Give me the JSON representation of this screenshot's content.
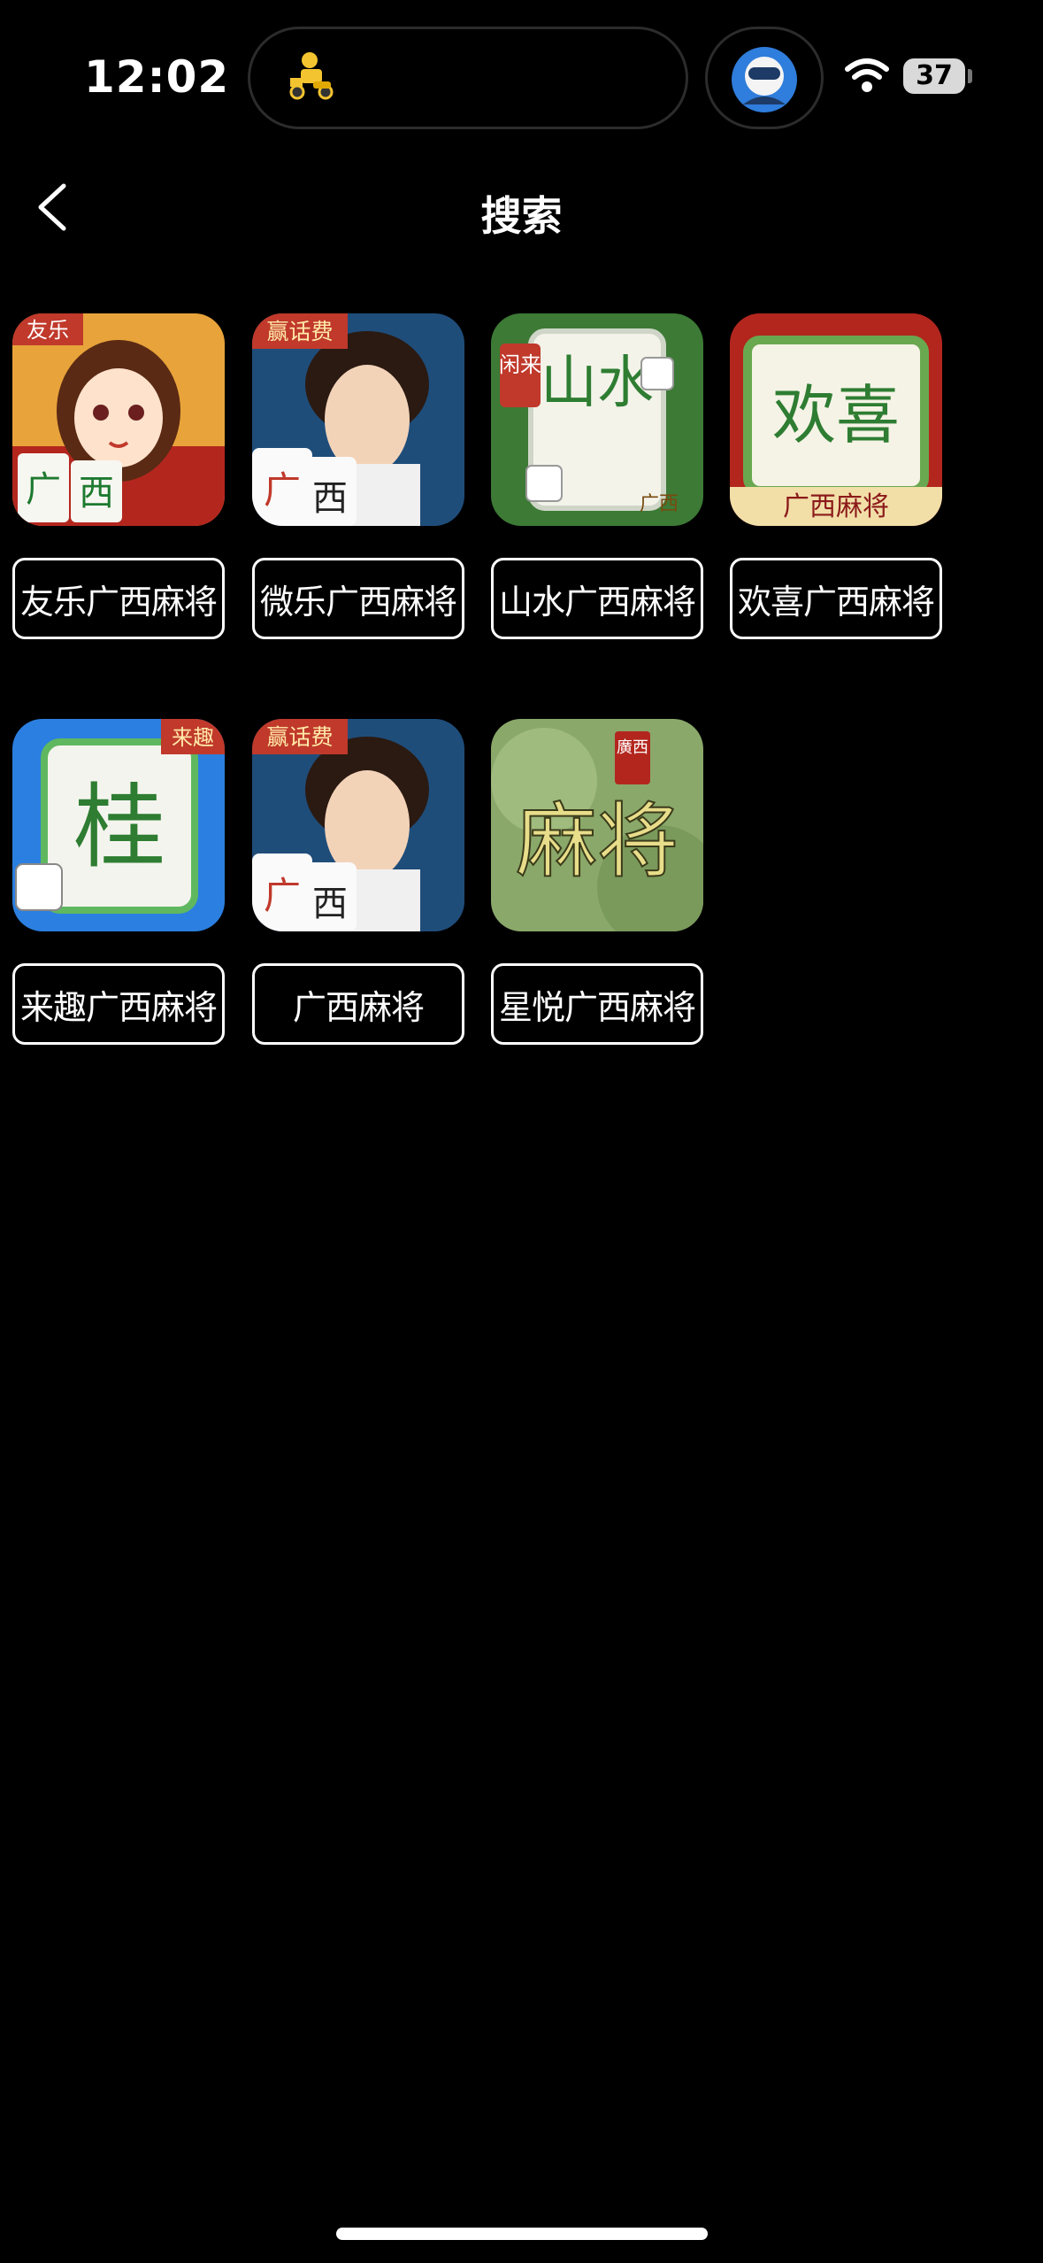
{
  "status_bar": {
    "time": "12:02",
    "battery": "37"
  },
  "header": {
    "title": "搜索"
  },
  "apps": [
    {
      "name": "友乐广西麻将",
      "icon": "girl-mahjong-icon",
      "badge": "友乐",
      "tiles": [
        "广",
        "西"
      ]
    },
    {
      "name": "微乐广西麻将",
      "icon": "man-cards-icon",
      "badge": "赢话费",
      "tiles": [
        "广",
        "西"
      ]
    },
    {
      "name": "山水广西麻将",
      "icon": "shanshui-tile-icon",
      "badge": "闲来",
      "big": "山水",
      "corner": "广西"
    },
    {
      "name": "欢喜广西麻将",
      "icon": "huanxi-tiles-icon",
      "big": "欢喜",
      "banner": "广西麻将"
    },
    {
      "name": "来趣广西麻将",
      "icon": "gui-tile-icon",
      "badge": "来趣",
      "big": "桂"
    },
    {
      "name": "广西麻将",
      "icon": "man-cards-icon",
      "badge": "赢话费",
      "tiles": [
        "广",
        "西"
      ]
    },
    {
      "name": "星悦广西麻将",
      "icon": "calligraphy-mahjong-icon",
      "seal": "廣西",
      "big": "麻将"
    }
  ]
}
